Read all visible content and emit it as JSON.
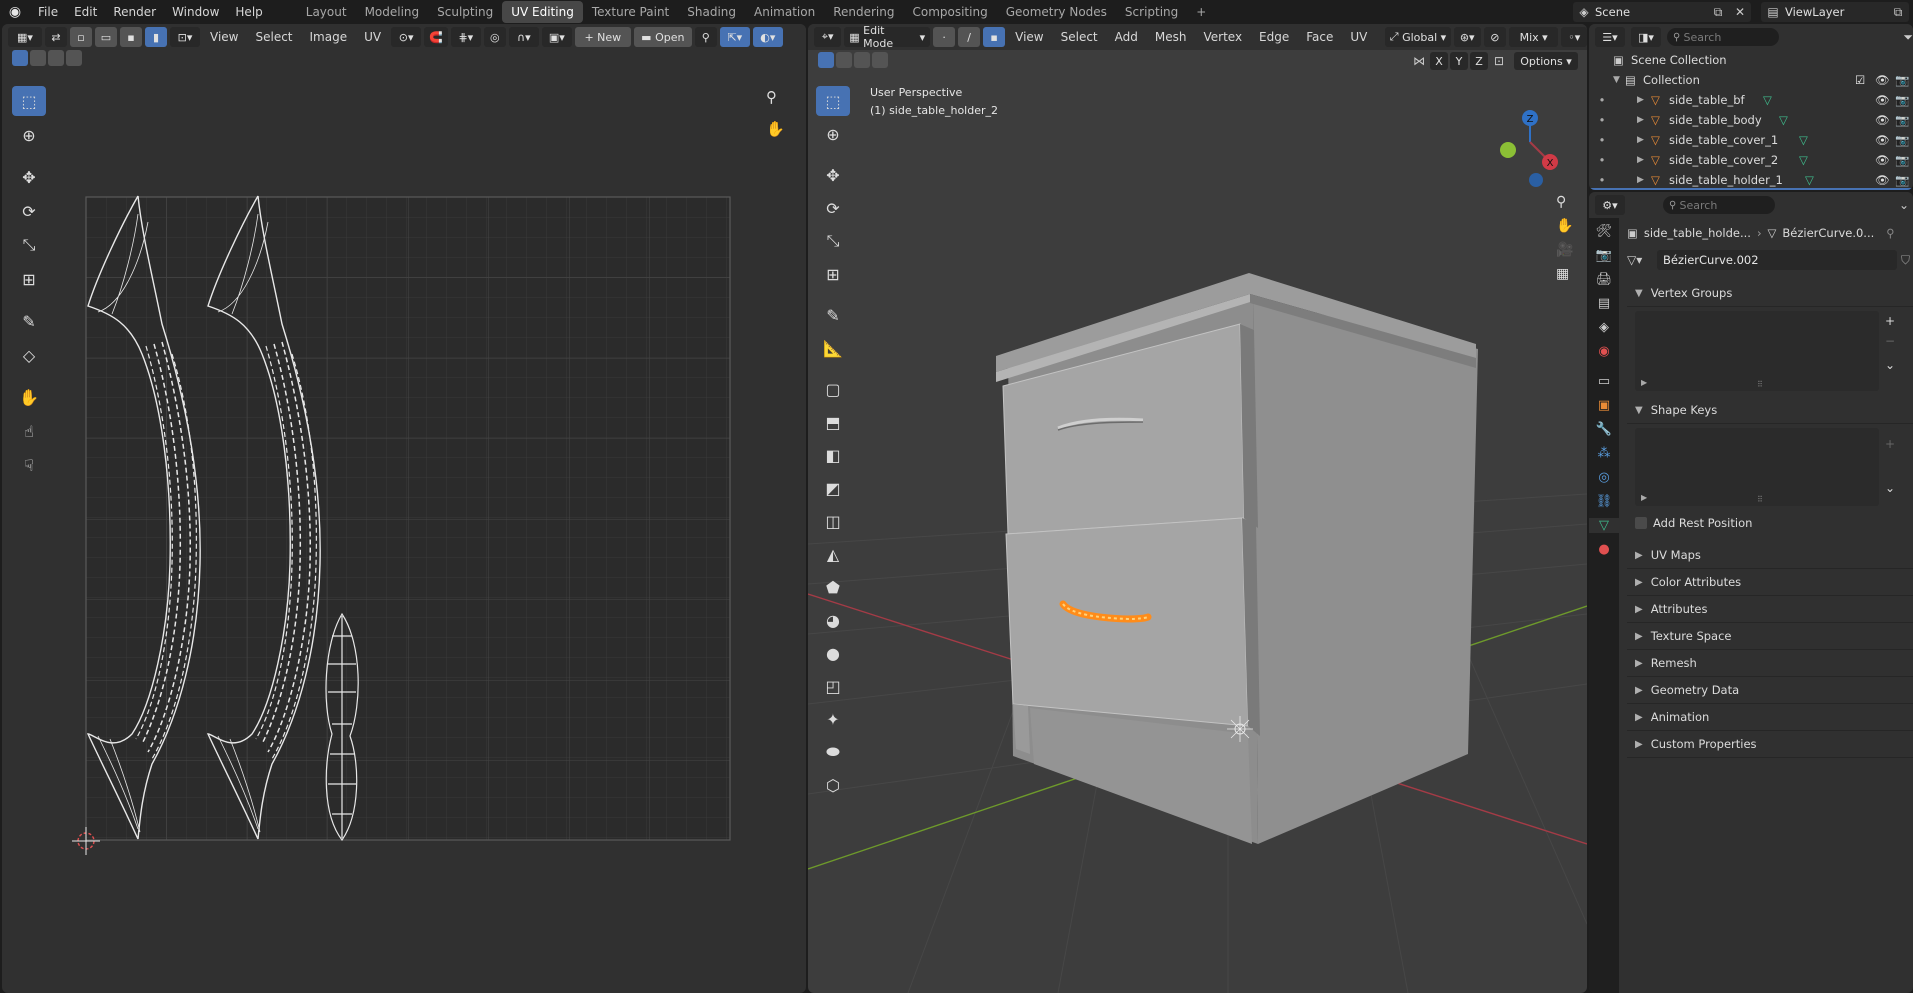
{
  "topbar": {
    "menus": [
      "File",
      "Edit",
      "Render",
      "Window",
      "Help"
    ],
    "workspaces": [
      "Layout",
      "Modeling",
      "Sculpting",
      "UV Editing",
      "Texture Paint",
      "Shading",
      "Animation",
      "Rendering",
      "Compositing",
      "Geometry Nodes",
      "Scripting"
    ],
    "active_workspace": "UV Editing",
    "add_symbol": "+",
    "scene": "Scene",
    "view_layer": "ViewLayer"
  },
  "uv_editor": {
    "menus": [
      "View",
      "Select",
      "Image",
      "UV"
    ],
    "new_label": "New",
    "open_label": "Open"
  },
  "viewport": {
    "mode": "Edit Mode",
    "menus": [
      "View",
      "Select",
      "Add",
      "Mesh",
      "Vertex",
      "Edge",
      "Face",
      "UV"
    ],
    "orientation": "Global",
    "shading": "Mix",
    "options_label": "Options",
    "axes": [
      "X",
      "Y",
      "Z"
    ],
    "overlay_title": "User Perspective",
    "overlay_object": "(1) side_table_holder_2",
    "gizmo_z": "Z",
    "gizmo_x": "X"
  },
  "outliner": {
    "search_placeholder": "Search",
    "scene_collection": "Scene Collection",
    "collection": "Collection",
    "items": [
      "side_table_bf",
      "side_table_body",
      "side_table_cover_1",
      "side_table_cover_2",
      "side_table_holder_1"
    ]
  },
  "properties": {
    "search_placeholder": "Search",
    "breadcrumb_object": "side_table_holde...",
    "breadcrumb_data": "BézierCurve.0...",
    "datablock_name": "BézierCurve.002",
    "vertex_groups": "Vertex Groups",
    "shape_keys": "Shape Keys",
    "add_rest_position": "Add Rest Position",
    "collapsed_panels": [
      "UV Maps",
      "Color Attributes",
      "Attributes",
      "Texture Space",
      "Remesh",
      "Geometry Data",
      "Animation",
      "Custom Properties"
    ]
  },
  "colors": {
    "accent": "#4772b3",
    "selected_edge": "#ff8c1a",
    "x_axis": "#a43b46",
    "y_axis": "#6e9a2b",
    "z_axis": "#2f71c6"
  }
}
